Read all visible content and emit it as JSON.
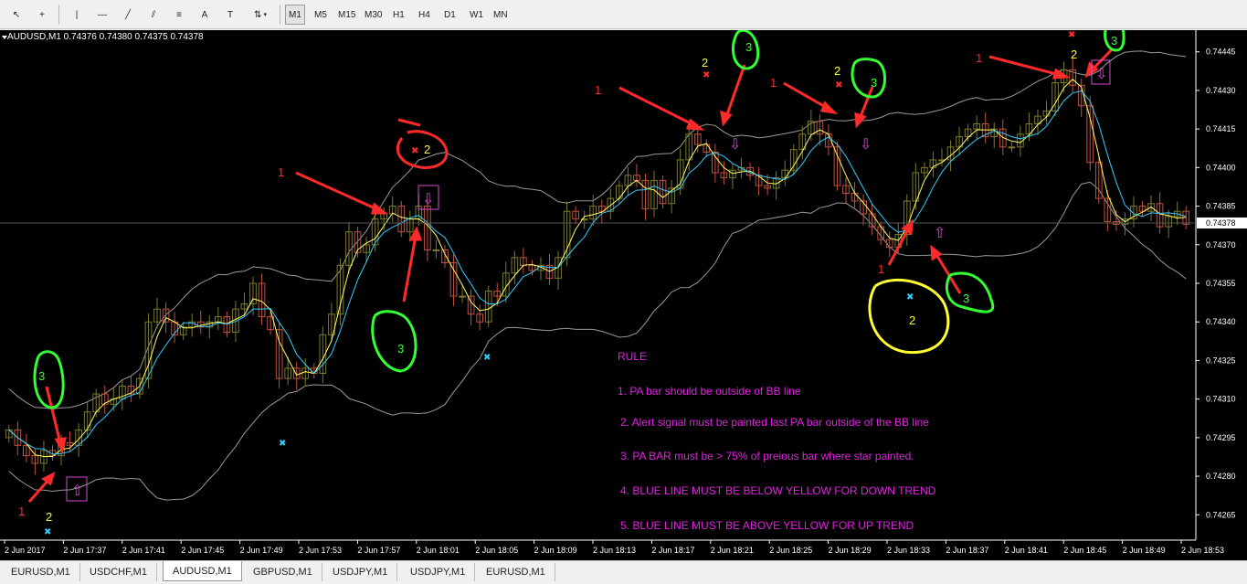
{
  "toolbar": {
    "tools": [
      {
        "name": "cursor-icon",
        "glyph": "↖"
      },
      {
        "name": "crosshair-icon",
        "glyph": "+"
      },
      {
        "name": "vertical-line-icon",
        "glyph": "|"
      },
      {
        "name": "horizontal-line-icon",
        "glyph": "—"
      },
      {
        "name": "trendline-icon",
        "glyph": "╱"
      },
      {
        "name": "equidistant-channel-icon",
        "glyph": "⫽"
      },
      {
        "name": "fibonacci-icon",
        "glyph": "≡"
      },
      {
        "name": "text-icon",
        "glyph": "A"
      },
      {
        "name": "text-label-icon",
        "glyph": "T"
      },
      {
        "name": "arrows-icon",
        "glyph": "⇅"
      }
    ],
    "timeframes": [
      "M1",
      "M5",
      "M15",
      "M30",
      "H1",
      "H4",
      "D1",
      "W1",
      "MN"
    ],
    "active_timeframe": "M1"
  },
  "symbol_info": "AUDUSD,M1  0.74376 0.74380 0.74375 0.74378",
  "chart_data": {
    "type": "candlestick",
    "symbol": "AUDUSD",
    "timeframe": "M1",
    "ohlc": {
      "open": 0.74376,
      "high": 0.7438,
      "low": 0.74375,
      "close": 0.74378
    },
    "current_price": "0.74378",
    "y_ticks": [
      "0.74445",
      "0.74430",
      "0.74415",
      "0.74400",
      "0.74385",
      "0.74370",
      "0.74355",
      "0.74340",
      "0.74325",
      "0.74310",
      "0.74295",
      "0.74280",
      "0.74265"
    ],
    "y_tick_values": [
      0.74445,
      0.7443,
      0.74415,
      0.744,
      0.74385,
      0.7437,
      0.74355,
      0.7434,
      0.74325,
      0.7431,
      0.74295,
      0.7428,
      0.74265
    ],
    "ylim": [
      0.74258,
      0.74452
    ],
    "x_ticks": [
      "2 Jun 2017",
      "2 Jun 17:37",
      "2 Jun 17:41",
      "2 Jun 17:45",
      "2 Jun 17:49",
      "2 Jun 17:53",
      "2 Jun 17:57",
      "2 Jun 18:01",
      "2 Jun 18:05",
      "2 Jun 18:09",
      "2 Jun 18:13",
      "2 Jun 18:17",
      "2 Jun 18:21",
      "2 Jun 18:25",
      "2 Jun 18:29",
      "2 Jun 18:33",
      "2 Jun 18:37",
      "2 Jun 18:41",
      "2 Jun 18:45",
      "2 Jun 18:49",
      "2 Jun 18:53"
    ],
    "closes": [
      0.74298,
      0.74292,
      0.74288,
      0.74285,
      0.7429,
      0.74288,
      0.74293,
      0.74292,
      0.74298,
      0.74305,
      0.74312,
      0.74308,
      0.7431,
      0.74315,
      0.74312,
      0.74318,
      0.7434,
      0.74345,
      0.7434,
      0.74335,
      0.74338,
      0.7434,
      0.74338,
      0.7434,
      0.74342,
      0.74336,
      0.74345,
      0.74347,
      0.74355,
      0.74342,
      0.74337,
      0.74318,
      0.74322,
      0.74318,
      0.74322,
      0.7432,
      0.74335,
      0.74343,
      0.74362,
      0.74375,
      0.74367,
      0.7437,
      0.7438,
      0.74382,
      0.74385,
      0.74375,
      0.7438,
      0.74385,
      0.74368,
      0.74368,
      0.74363,
      0.7435,
      0.7435,
      0.74343,
      0.7434,
      0.74352,
      0.7435,
      0.74359,
      0.74365,
      0.74362,
      0.7436,
      0.74362,
      0.74357,
      0.74365,
      0.74383,
      0.7438,
      0.7438,
      0.74385,
      0.74383,
      0.74388,
      0.74393,
      0.74397,
      0.74395,
      0.74384,
      0.74395,
      0.74386,
      0.74392,
      0.74403,
      0.74413,
      0.74409,
      0.74406,
      0.74398,
      0.74396,
      0.74399,
      0.744,
      0.74397,
      0.74393,
      0.74392,
      0.74396,
      0.74399,
      0.74407,
      0.74413,
      0.74418,
      0.74413,
      0.74408,
      0.74393,
      0.7439,
      0.74387,
      0.74382,
      0.74377,
      0.74372,
      0.74369,
      0.74374,
      0.74387,
      0.74398,
      0.744,
      0.74403,
      0.74403,
      0.74408,
      0.74412,
      0.74415,
      0.74417,
      0.74412,
      0.74415,
      0.74408,
      0.74408,
      0.74413,
      0.74417,
      0.7442,
      0.74422,
      0.74433,
      0.74438,
      0.74432,
      0.74424,
      0.74402,
      0.74388,
      0.74379,
      0.74378,
      0.7438,
      0.74385,
      0.74383,
      0.74386,
      0.74377,
      0.74381,
      0.74383,
      0.74378
    ],
    "series": [
      {
        "name": "",
        "color": "#ffff66",
        "style": "moving average"
      },
      {
        "name": "",
        "color": "#33ccff",
        "style": "moving average"
      },
      {
        "name": "",
        "color": "#9a9a9a",
        "style": "Bollinger band upper"
      },
      {
        "name": "",
        "color": "#9a9a9a",
        "style": "Bollinger band lower"
      }
    ],
    "colors": {
      "bull": "#7a7a2a",
      "bear": "#c0523e",
      "fast_ma": "#ffff66",
      "slow_ma": "#33ccff",
      "bands": "#9a9a9a",
      "annotation_red": "#ff2a2a",
      "annotation_green": "#33ff33",
      "annotation_yellow": "#ffff33",
      "rule_text": "#e022e0"
    },
    "annotations": {
      "labels_red": [
        "1",
        "1",
        "1",
        "1",
        "1",
        "1",
        "2"
      ],
      "labels_yellow": [
        "2",
        "2",
        "2",
        "2",
        "2"
      ],
      "labels_green": [
        "3",
        "3",
        "3",
        "3",
        "3",
        "3"
      ]
    },
    "rules": [
      "RULE",
      "1. PA bar should be outside of BB line",
      "2. Alert signal must be painted last PA bar outside of the BB line",
      "3. PA BAR must be > 75% of preious bar where star painted.",
      "4. BLUE LINE MUST BE BELOW YELLOW FOR DOWN TREND",
      "5. BLUE LINE MUST BE ABOVE YELLOW FOR UP TREND"
    ]
  },
  "tabs": [
    {
      "label": "EURUSD,M1",
      "active": false
    },
    {
      "label": "USDCHF,M1",
      "active": false
    },
    {
      "label": "AUDUSD,M1",
      "active": true
    },
    {
      "label": "GBPUSD,M1",
      "active": false
    },
    {
      "label": "USDJPY,M1",
      "active": false
    },
    {
      "label": "USDJPY,M1",
      "active": false
    },
    {
      "label": "EURUSD,M1",
      "active": false
    }
  ]
}
